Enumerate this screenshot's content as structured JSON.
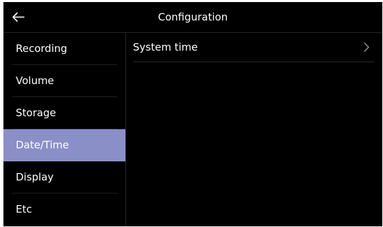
{
  "header": {
    "title": "Configuration",
    "back_icon": "arrow-left-icon"
  },
  "sidebar": {
    "items": [
      {
        "label": "Recording"
      },
      {
        "label": "Volume"
      },
      {
        "label": "Storage"
      },
      {
        "label": "Date/Time",
        "active": true
      },
      {
        "label": "Display"
      },
      {
        "label": "Etc"
      }
    ]
  },
  "content": {
    "rows": [
      {
        "label": "System time",
        "icon": "chevron-right-icon"
      }
    ]
  },
  "colors": {
    "background": "#000000",
    "accent": "#8b8fc8",
    "text": "#ffffff"
  }
}
